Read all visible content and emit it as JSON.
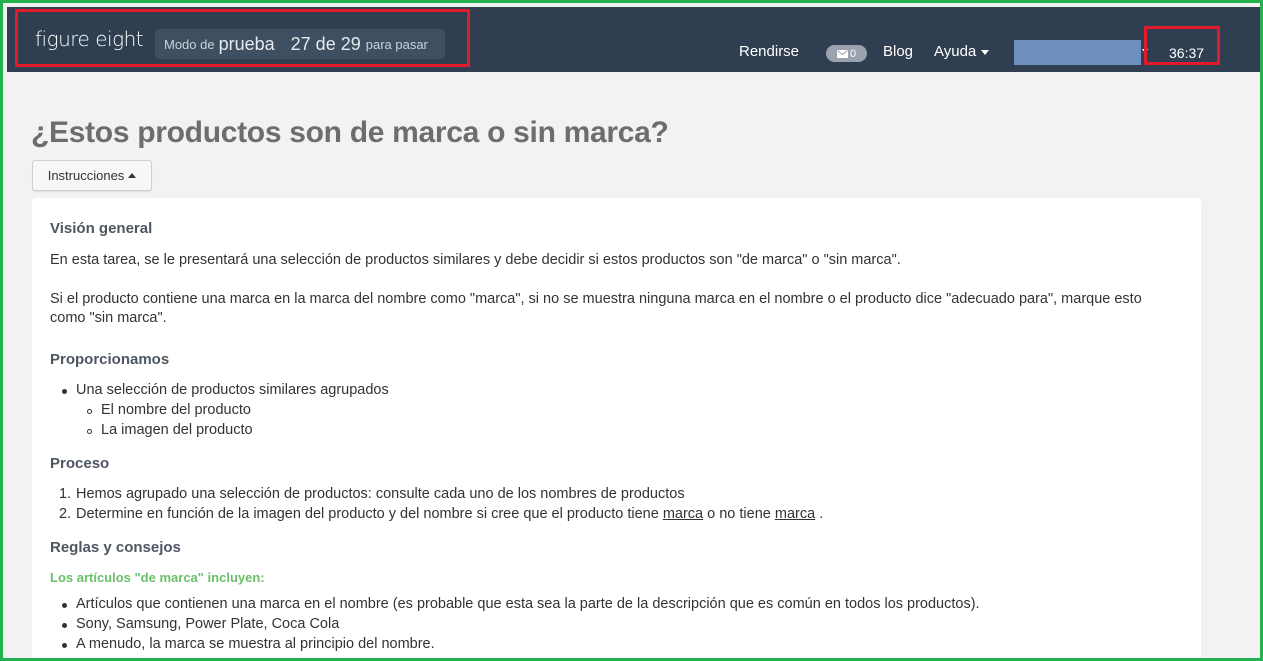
{
  "header": {
    "logo": "figure eight",
    "mode_prefix": "Modo de",
    "mode_value": "prueba",
    "count": "27 de 29",
    "count_suffix": "para pasar",
    "nav": {
      "surrender": "Rendirse",
      "mail_count": "0",
      "blog": "Blog",
      "help": "Ayuda"
    },
    "timer": "36:37"
  },
  "page": {
    "title": "¿Estos productos son de marca o sin marca?",
    "instructions_button": "Instrucciones"
  },
  "instructions": {
    "overview_heading": "Visión general",
    "overview_p1": "En esta tarea, se le presentará una selección de productos similares y debe decidir si estos productos son \"de marca\" o \"sin marca\".",
    "overview_p2": "Si el producto contiene una marca en la marca del nombre como \"marca\", si no se muestra ninguna marca en el nombre o el producto dice \"adecuado para\", marque esto como \"sin marca\".",
    "provide_heading": "Proporcionamos",
    "provide_item": "Una selección de productos similares agrupados",
    "provide_sub1": "El nombre del producto",
    "provide_sub2": "La imagen del producto",
    "process_heading": "Proceso",
    "process_1": "Hemos agrupado una selección de productos: consulte cada uno de los nombres de productos",
    "process_2_a": "Determine en función de la imagen del producto y del nombre si cree que el producto tiene",
    "process_2_link1": "marca",
    "process_2_b": "o no tiene",
    "process_2_link2": "marca",
    "process_2_c": ".",
    "rules_heading": "Reglas y consejos",
    "branded_subheading": "Los artículos \"de marca\" incluyen:",
    "branded_1": "Artículos que contienen una marca en el nombre (es probable que esta sea la parte de la descripción que es común en todos los productos).",
    "branded_2": "Sony, Samsung, Power Plate, Coca Cola",
    "branded_3": "A menudo, la marca se muestra al principio del nombre."
  },
  "colors": {
    "topbar": "#2f3e50",
    "highlight_border": "#e21b2c",
    "frame_border": "#22b14c",
    "green_subheading": "#6bbf6b"
  }
}
